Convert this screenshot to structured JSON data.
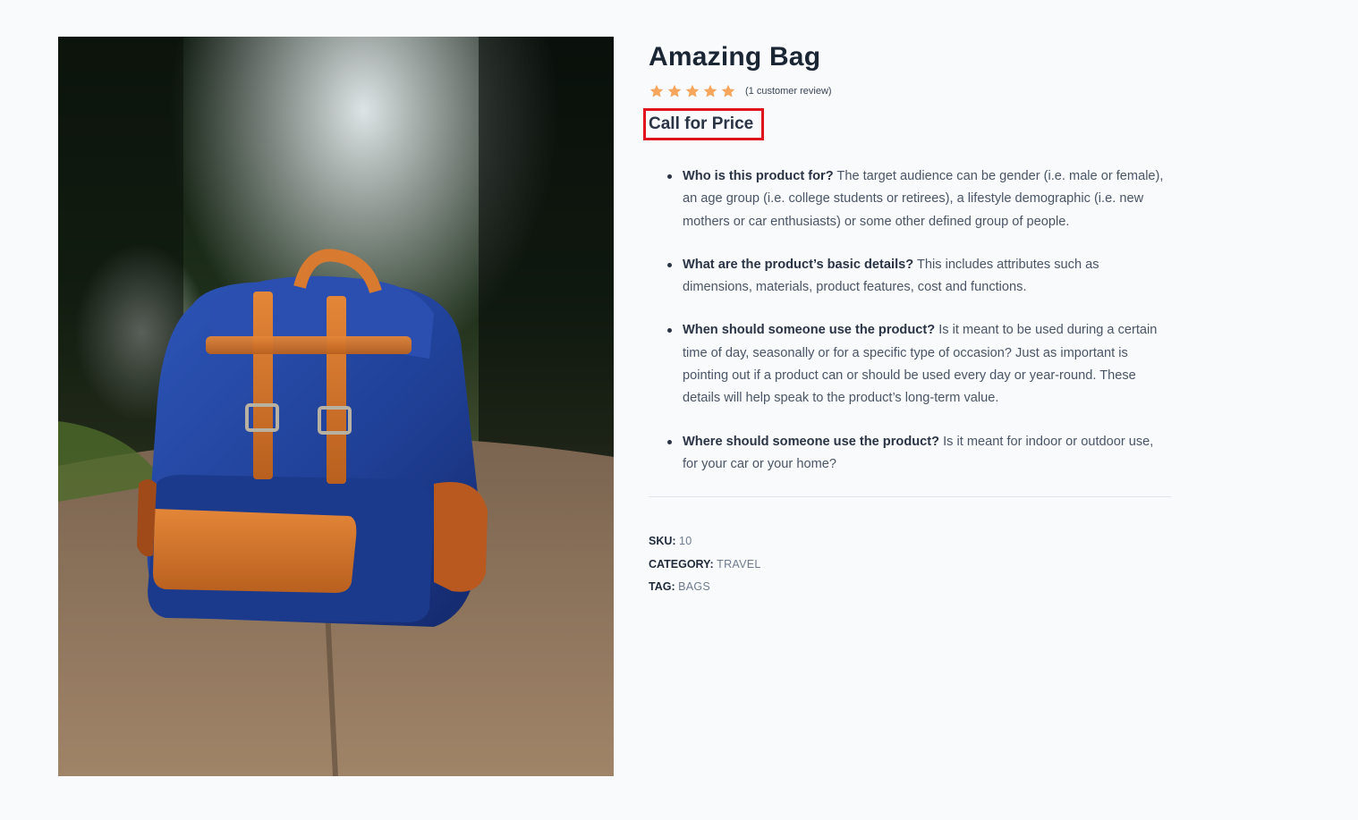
{
  "product": {
    "image_alt": "Blue canvas backpack with orange leather straps on a path",
    "title": "Amazing Bag",
    "rating": {
      "stars": 5,
      "max_stars": 5,
      "review_text": "(1 customer review)"
    },
    "price_label": "Call for Price",
    "description": [
      {
        "heading": "Who is this product for?",
        "text": " The target audience can be gender (i.e. male or female), an age group (i.e. college students or retirees), a lifestyle demographic (i.e. new mothers or car enthusiasts) or some other defined group of people."
      },
      {
        "heading": "What are the product’s basic details?",
        "text": " This includes attributes such as dimensions, materials, product features, cost and functions."
      },
      {
        "heading": "When should someone use the product?",
        "text": " Is it meant to be used during a certain time of day, seasonally or for a specific type of occasion? Just as important is pointing out if a product can or should be used every day or year-round. These details will help speak to the product’s long-term value."
      },
      {
        "heading": "Where should someone use the product?",
        "text": " Is it meant for indoor or outdoor use, for your car or your home?"
      }
    ],
    "meta": {
      "sku_label": "SKU:",
      "sku_value": "10",
      "category_label": "CATEGORY:",
      "category_value": "TRAVEL",
      "tag_label": "TAG:",
      "tag_value": "BAGS"
    }
  },
  "colors": {
    "star": "#f5a55c",
    "price_highlight_border": "#e0141c",
    "title": "#1b2635",
    "background": "#f8fafc"
  },
  "icons": {
    "star": "star-icon"
  }
}
